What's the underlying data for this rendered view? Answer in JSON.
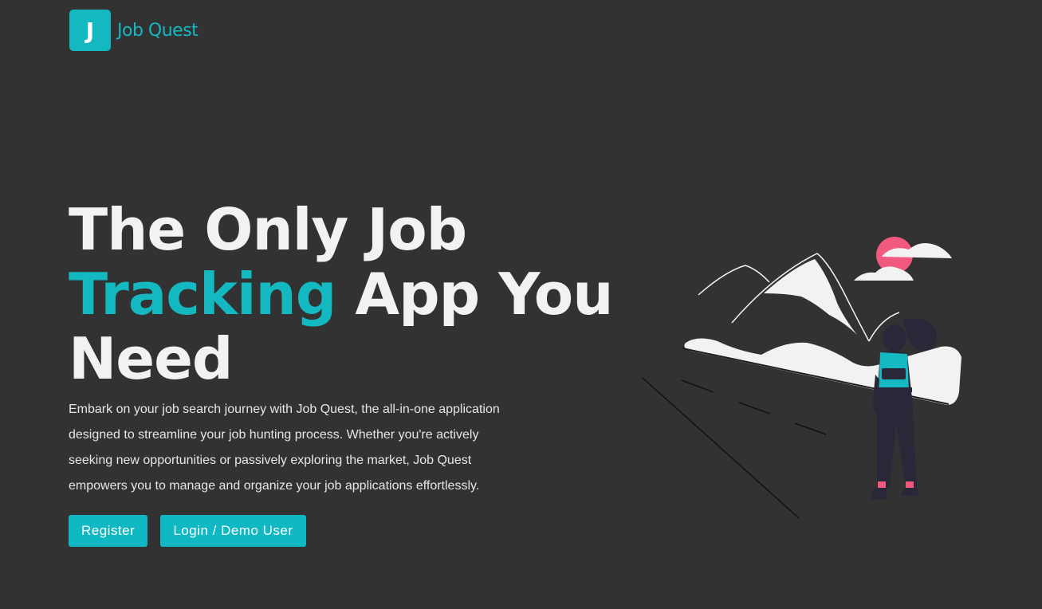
{
  "brand": {
    "logo_letter": "J",
    "name": "Job Quest",
    "color": "#14b8c0"
  },
  "hero": {
    "title_line1": "The Only Job",
    "title_accent": "Tracking",
    "title_line2_rest": " App You",
    "title_line3": "Need",
    "description": "Embark on your job search journey with Job Quest, the all-in-one application designed to streamline your job hunting process. Whether you're actively seeking new opportunities or passively exploring the market, Job Quest empowers you to manage and organize your job applications effortlessly."
  },
  "buttons": {
    "register_label": "Register",
    "login_label": "Login / Demo User"
  },
  "colors": {
    "background": "#323232",
    "accent": "#14b8c0",
    "sun": "#f2597f"
  }
}
